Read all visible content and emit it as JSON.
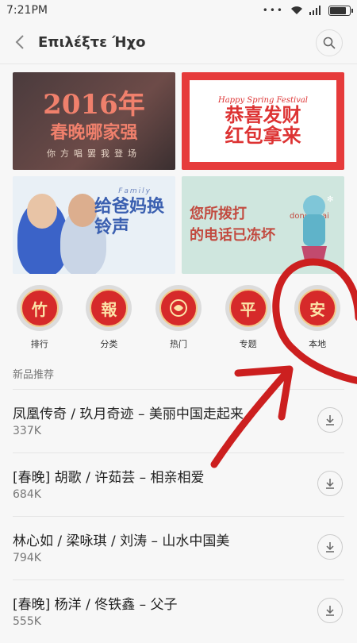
{
  "status": {
    "time": "7:21PM",
    "battery_level": 0.9
  },
  "header": {
    "title": "Επιλέξτε Ήχο"
  },
  "banners": [
    {
      "line1": "2016年",
      "line2": "春晚哪家强",
      "line3": "你方唱罢我登场"
    },
    {
      "english": "Happy Spring Festival",
      "line1": "恭喜发财",
      "line2": "红包拿来"
    },
    {
      "english": "Family",
      "line1": "给爸妈换",
      "line2": "铃声"
    },
    {
      "line1": "您所拨打",
      "line2": "的电话已冻坏",
      "english": "dong huai"
    }
  ],
  "categories": [
    {
      "glyph": "竹",
      "label": "排行"
    },
    {
      "glyph": "報",
      "label": "分类"
    },
    {
      "glyph": "",
      "label": "热门"
    },
    {
      "glyph": "平",
      "label": "专题"
    },
    {
      "glyph": "安",
      "label": "本地"
    }
  ],
  "section_title": "新品推荐",
  "songs": [
    {
      "title": "凤凰传奇 / 玖月奇迹 – 美丽中国走起来",
      "size": "337K"
    },
    {
      "title": "[春晚] 胡歌 / 许茹芸 – 相亲相爱",
      "size": "684K"
    },
    {
      "title": "林心如 / 梁咏琪 / 刘涛 – 山水中国美",
      "size": "794K"
    },
    {
      "title": "[春晚] 杨洋 / 佟铁鑫 – 父子",
      "size": "555K"
    }
  ],
  "colors": {
    "accent_red": "#d62a2a",
    "annotation_red": "#cc1f1f"
  }
}
